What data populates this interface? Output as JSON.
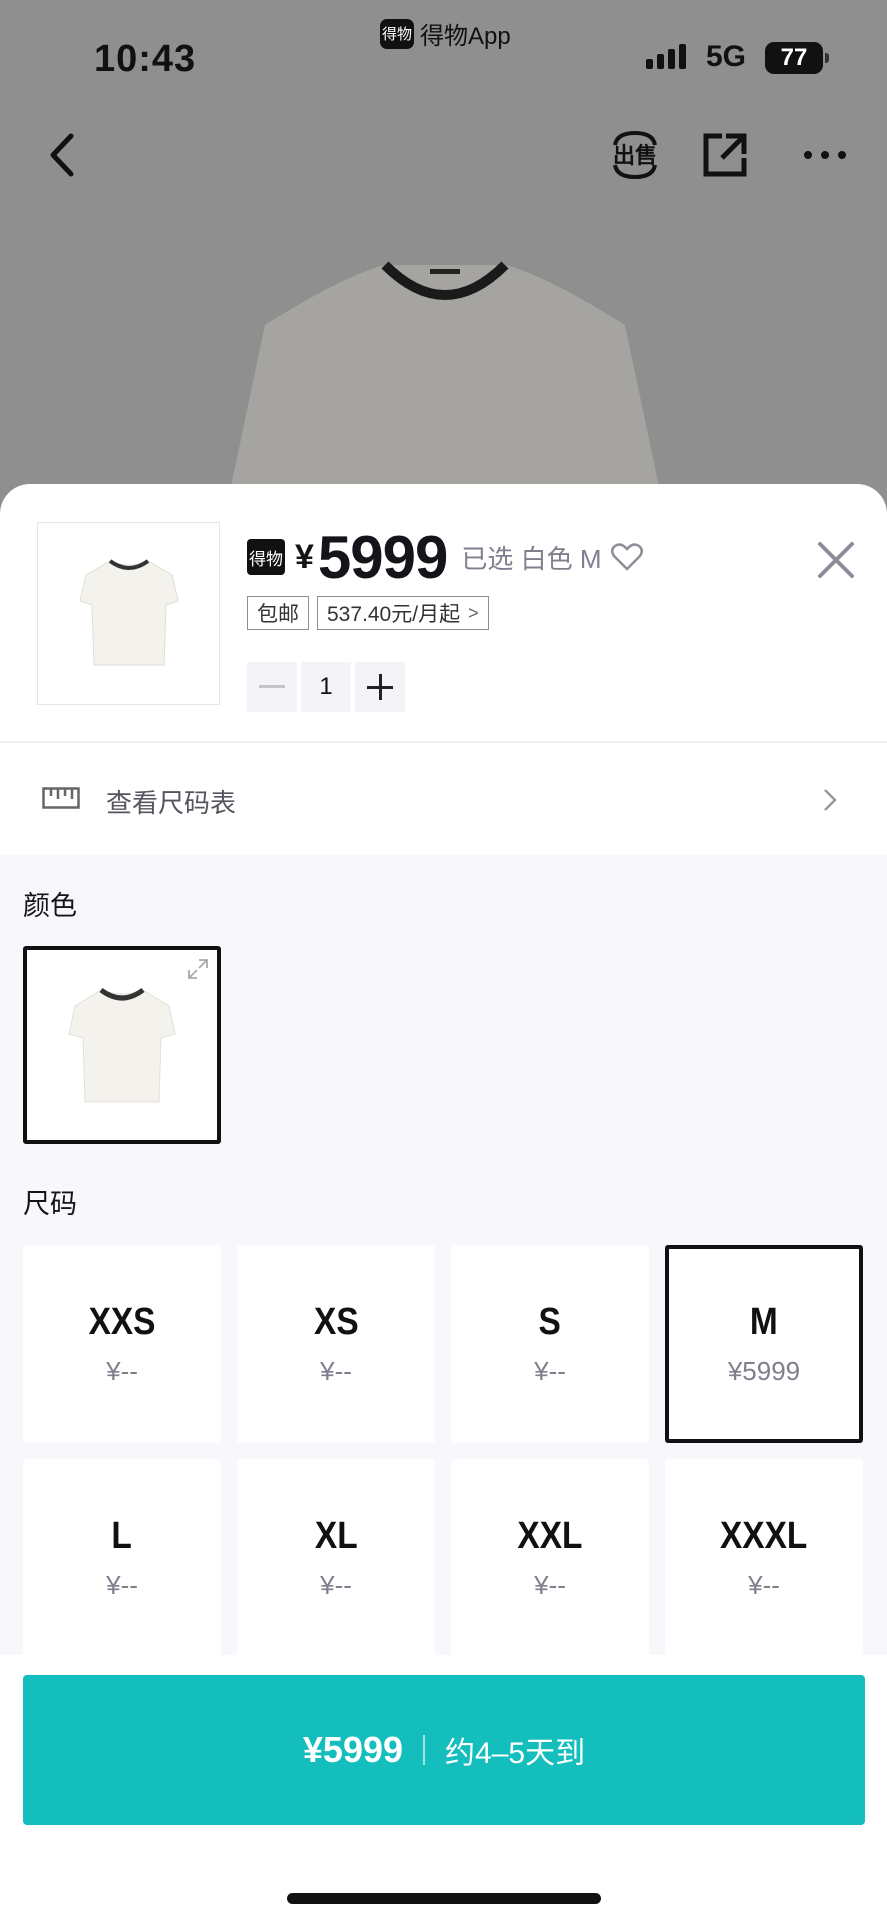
{
  "status_bar": {
    "time": "10:43",
    "app_name": "得物App",
    "app_logo_text": "得物",
    "network": "5G",
    "battery": "77"
  },
  "nav": {
    "back_icon": "chevron-left-icon",
    "sell_label": "出售",
    "share_icon": "share-icon",
    "more_icon": "more-icon"
  },
  "product": {
    "logo_text": "得物",
    "currency": "¥",
    "price": "5999",
    "selected_label": "已选  白色  M",
    "free_shipping": "包邮",
    "installment": "537.40元/月起",
    "quantity": "1"
  },
  "size_chart": {
    "label": "查看尺码表"
  },
  "color_section": {
    "title": "颜色",
    "selected_index": 0
  },
  "size_section": {
    "title": "尺码",
    "sizes": [
      {
        "name": "XXS",
        "price": "¥--"
      },
      {
        "name": "XS",
        "price": "¥--"
      },
      {
        "name": "S",
        "price": "¥--"
      },
      {
        "name": "M",
        "price": "¥5999"
      },
      {
        "name": "L",
        "price": "¥--"
      },
      {
        "name": "XL",
        "price": "¥--"
      },
      {
        "name": "XXL",
        "price": "¥--"
      },
      {
        "name": "XXXL",
        "price": "¥--"
      }
    ],
    "selected": "M"
  },
  "buy_button": {
    "price": "¥5999",
    "eta": "约4–5天到"
  },
  "colors": {
    "accent": "#13bebd",
    "text_secondary": "#7f7f8e"
  }
}
